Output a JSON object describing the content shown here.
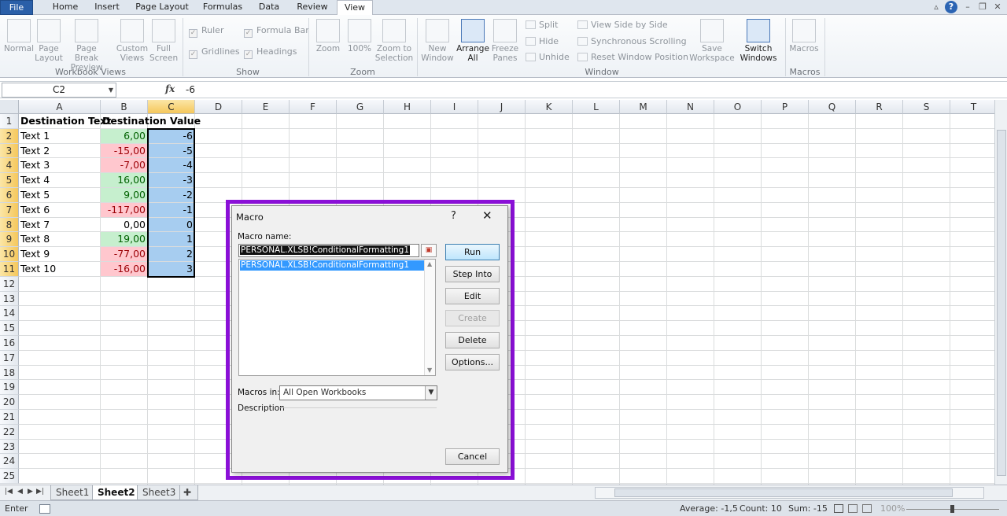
{
  "tabs": [
    {
      "label": "File"
    },
    {
      "label": "Home"
    },
    {
      "label": "Insert"
    },
    {
      "label": "Page Layout"
    },
    {
      "label": "Formulas"
    },
    {
      "label": "Data"
    },
    {
      "label": "Review"
    },
    {
      "label": "View"
    }
  ],
  "ribbon": {
    "workbook_views": {
      "normal": "Normal",
      "page_layout": "Page Layout",
      "page_break_preview": "Page Break Preview",
      "custom_views": "Custom Views",
      "full_screen": "Full Screen",
      "label": "Workbook Views"
    },
    "show": {
      "ruler": "Ruler",
      "gridlines": "Gridlines",
      "formula_bar": "Formula Bar",
      "headings": "Headings",
      "label": "Show"
    },
    "zoom": {
      "zoom": "Zoom",
      "zoom100": "100%",
      "zoom_selection": "Zoom to Selection",
      "label": "Zoom"
    },
    "window": {
      "new_window": "New Window",
      "arrange_all": "Arrange All",
      "freeze_panes": "Freeze Panes",
      "split": "Split",
      "hide": "Hide",
      "unhide": "Unhide",
      "view_side": "View Side by Side",
      "sync_scroll": "Synchronous Scrolling",
      "reset_pos": "Reset Window Position",
      "save_workspace": "Save Workspace",
      "switch_windows": "Switch Windows",
      "label": "Window"
    },
    "macros": {
      "macros": "Macros",
      "label": "Macros"
    }
  },
  "formula_bar": {
    "name_box": "C2",
    "fx": "fx",
    "value": "-6"
  },
  "sheet": {
    "columns": [
      "A",
      "B",
      "C",
      "D",
      "E",
      "F",
      "G",
      "H",
      "I",
      "J",
      "K",
      "L",
      "M",
      "N",
      "O",
      "P",
      "Q",
      "R",
      "S",
      "T"
    ],
    "rows": [
      "1",
      "2",
      "3",
      "4",
      "5",
      "6",
      "7",
      "8",
      "9",
      "10",
      "11",
      "12",
      "13",
      "14",
      "15",
      "16",
      "17",
      "18",
      "19",
      "20",
      "21",
      "22",
      "23",
      "24",
      "25"
    ],
    "header_a": "Destination Text",
    "header_b": "Destination Value",
    "data": [
      {
        "a": "Text 1",
        "b": "6,00",
        "c": "-6",
        "tone": "green"
      },
      {
        "a": "Text 2",
        "b": "-15,00",
        "c": "-5",
        "tone": "red"
      },
      {
        "a": "Text 3",
        "b": "-7,00",
        "c": "-4",
        "tone": "red"
      },
      {
        "a": "Text 4",
        "b": "16,00",
        "c": "-3",
        "tone": "green"
      },
      {
        "a": "Text 5",
        "b": "9,00",
        "c": "-2",
        "tone": "green"
      },
      {
        "a": "Text 6",
        "b": "-117,00",
        "c": "-1",
        "tone": "red"
      },
      {
        "a": "Text 7",
        "b": "0,00",
        "c": "0",
        "tone": "none"
      },
      {
        "a": "Text 8",
        "b": "19,00",
        "c": "1",
        "tone": "green"
      },
      {
        "a": "Text 9",
        "b": "-77,00",
        "c": "2",
        "tone": "red"
      },
      {
        "a": "Text 10",
        "b": "-16,00",
        "c": "3",
        "tone": "red"
      }
    ]
  },
  "sheet_tabs": [
    "Sheet1",
    "Sheet2",
    "Sheet3"
  ],
  "status": {
    "mode": "Enter",
    "average": "Average: -1,5",
    "count": "Count: 10",
    "sum": "Sum: -15",
    "zoom": "100%"
  },
  "dialog": {
    "title": "Macro",
    "help": "?",
    "close": "✕",
    "macro_name_label": "Macro name:",
    "macro_name_value": "PERSONAL.XLSB!ConditionalFormatting1",
    "list_items": [
      "PERSONAL.XLSB!ConditionalFormatting1"
    ],
    "buttons": {
      "run": "Run",
      "step_into": "Step Into",
      "edit": "Edit",
      "create": "Create",
      "delete": "Delete",
      "options": "Options...",
      "cancel": "Cancel"
    },
    "macros_in_label": "Macros in:",
    "macros_in_value": "All Open Workbooks",
    "description_label": "Description"
  },
  "colors": {
    "accent": "#8b10d8",
    "file_tab": "#2a5fa8",
    "good_fill": "#c6efce",
    "bad_fill": "#ffc7ce",
    "blue_fill": "#a7cdf0"
  }
}
